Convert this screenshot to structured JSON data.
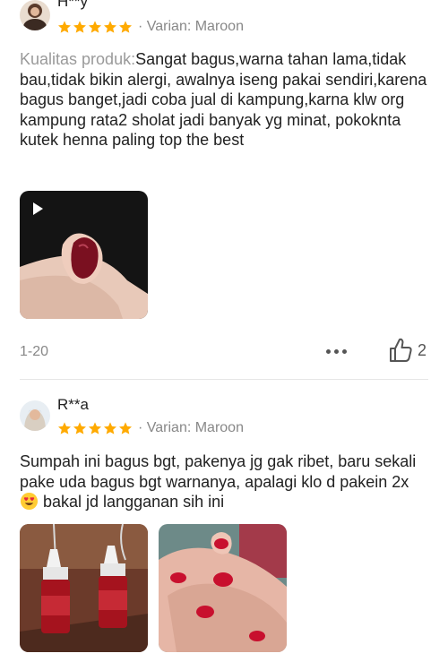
{
  "reviews": [
    {
      "username": "H**y",
      "rating": 5,
      "variant": "· Varian: Maroon",
      "label": "Kualitas produk:",
      "text": "Sangat bagus,warna tahan lama,tidak bau,tidak bikin alergi, awalnya iseng pakai sendiri,karena bagus banget,jadi coba jual di kampung,karna klw org kampung rata2 sholat  jadi banyak yg minat, pokoknta kutek henna paling top the best",
      "media_icon": "play-icon",
      "date": "1-20",
      "likes": "2"
    },
    {
      "username": "R**a",
      "rating": 5,
      "variant": "· Varian: Maroon",
      "text_before": "Sumpah ini bagus bgt, pakenya jg gak ribet, baru sekali pake uda bagus bgt warnanya, apalagi klo d pakein 2x",
      "emoji": "heart-eyes-emoji",
      "text_after": " bakal jd langganan sih ini"
    }
  ],
  "colors": {
    "star": "#FFAA00",
    "nail_maroon": "#7a1020",
    "nail_red": "#c8102e"
  }
}
